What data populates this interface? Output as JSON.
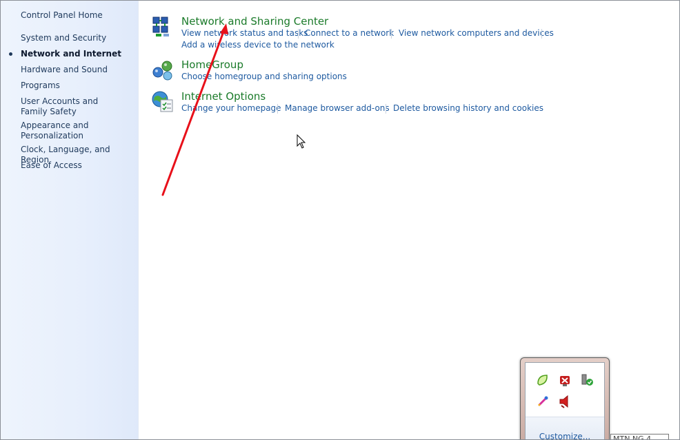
{
  "sidebar": {
    "home": "Control Panel Home",
    "items": [
      {
        "label": "System and Security"
      },
      {
        "label": "Network and Internet",
        "active": true
      },
      {
        "label": "Hardware and Sound"
      },
      {
        "label": "Programs"
      },
      {
        "label": "User Accounts and Family Safety"
      },
      {
        "label": "Appearance and Personalization"
      },
      {
        "label": "Clock, Language, and Region"
      },
      {
        "label": "Ease of Access"
      }
    ]
  },
  "categories": [
    {
      "title": "Network and Sharing Center",
      "icon": "network-icon",
      "tasks": [
        "View network status and tasks",
        "Connect to a network",
        "View network computers and devices",
        "Add a wireless device to the network"
      ]
    },
    {
      "title": "HomeGroup",
      "icon": "homegroup-icon",
      "tasks": [
        "Choose homegroup and sharing options"
      ]
    },
    {
      "title": "Internet Options",
      "icon": "internet-options-icon",
      "tasks": [
        "Change your homepage",
        "Manage browser add-ons",
        "Delete browsing history and cookies"
      ]
    }
  ],
  "tray": {
    "customize": "Customize...",
    "tooltip": "MTN NG 4",
    "icons": [
      "leaf-icon",
      "network-error-icon",
      "usb-safe-remove-icon",
      "pen-icon",
      "speaker-icon"
    ]
  },
  "colors": {
    "category_title": "#1a7a29",
    "link": "#1e5aa0",
    "annotation_arrow": "#e8101a"
  }
}
